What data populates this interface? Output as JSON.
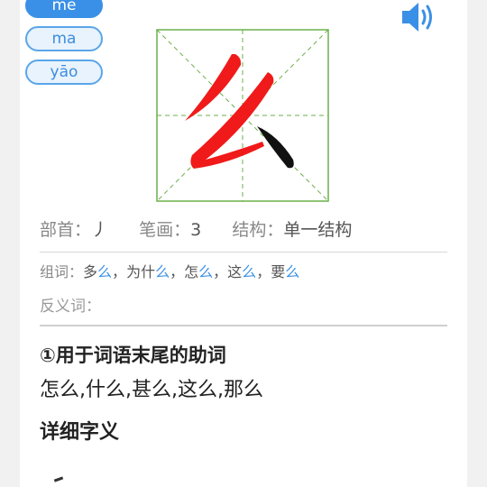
{
  "title_partial": "",
  "pinyin": [
    {
      "label": "me",
      "active": true
    },
    {
      "label": "ma",
      "active": false
    },
    {
      "label": "yāo",
      "active": false
    }
  ],
  "info": {
    "radical_label": "部首：",
    "radical": "丿",
    "strokes_label": "笔画：",
    "strokes": "3",
    "structure_label": "结构：",
    "structure": "单一结构"
  },
  "words": {
    "label": "组词：",
    "items": [
      {
        "prefix": "多",
        "char": "么"
      },
      {
        "prefix": "为什",
        "char": "么"
      },
      {
        "prefix": "怎",
        "char": "么"
      },
      {
        "prefix": "这",
        "char": "么"
      },
      {
        "prefix": "要",
        "char": "么"
      }
    ],
    "separator": "，"
  },
  "antonym_label": "反义词：",
  "definition": {
    "title": "①用于词语末尾的助词",
    "examples": "怎么,什么,甚么,这么,那么"
  },
  "detail_title": "详细字义",
  "colors": {
    "accent": "#3a90e6",
    "stroke_highlight": "#f01a1a",
    "grid_line": "#6bb04a"
  },
  "icons": {
    "sound": "speaker-icon"
  }
}
